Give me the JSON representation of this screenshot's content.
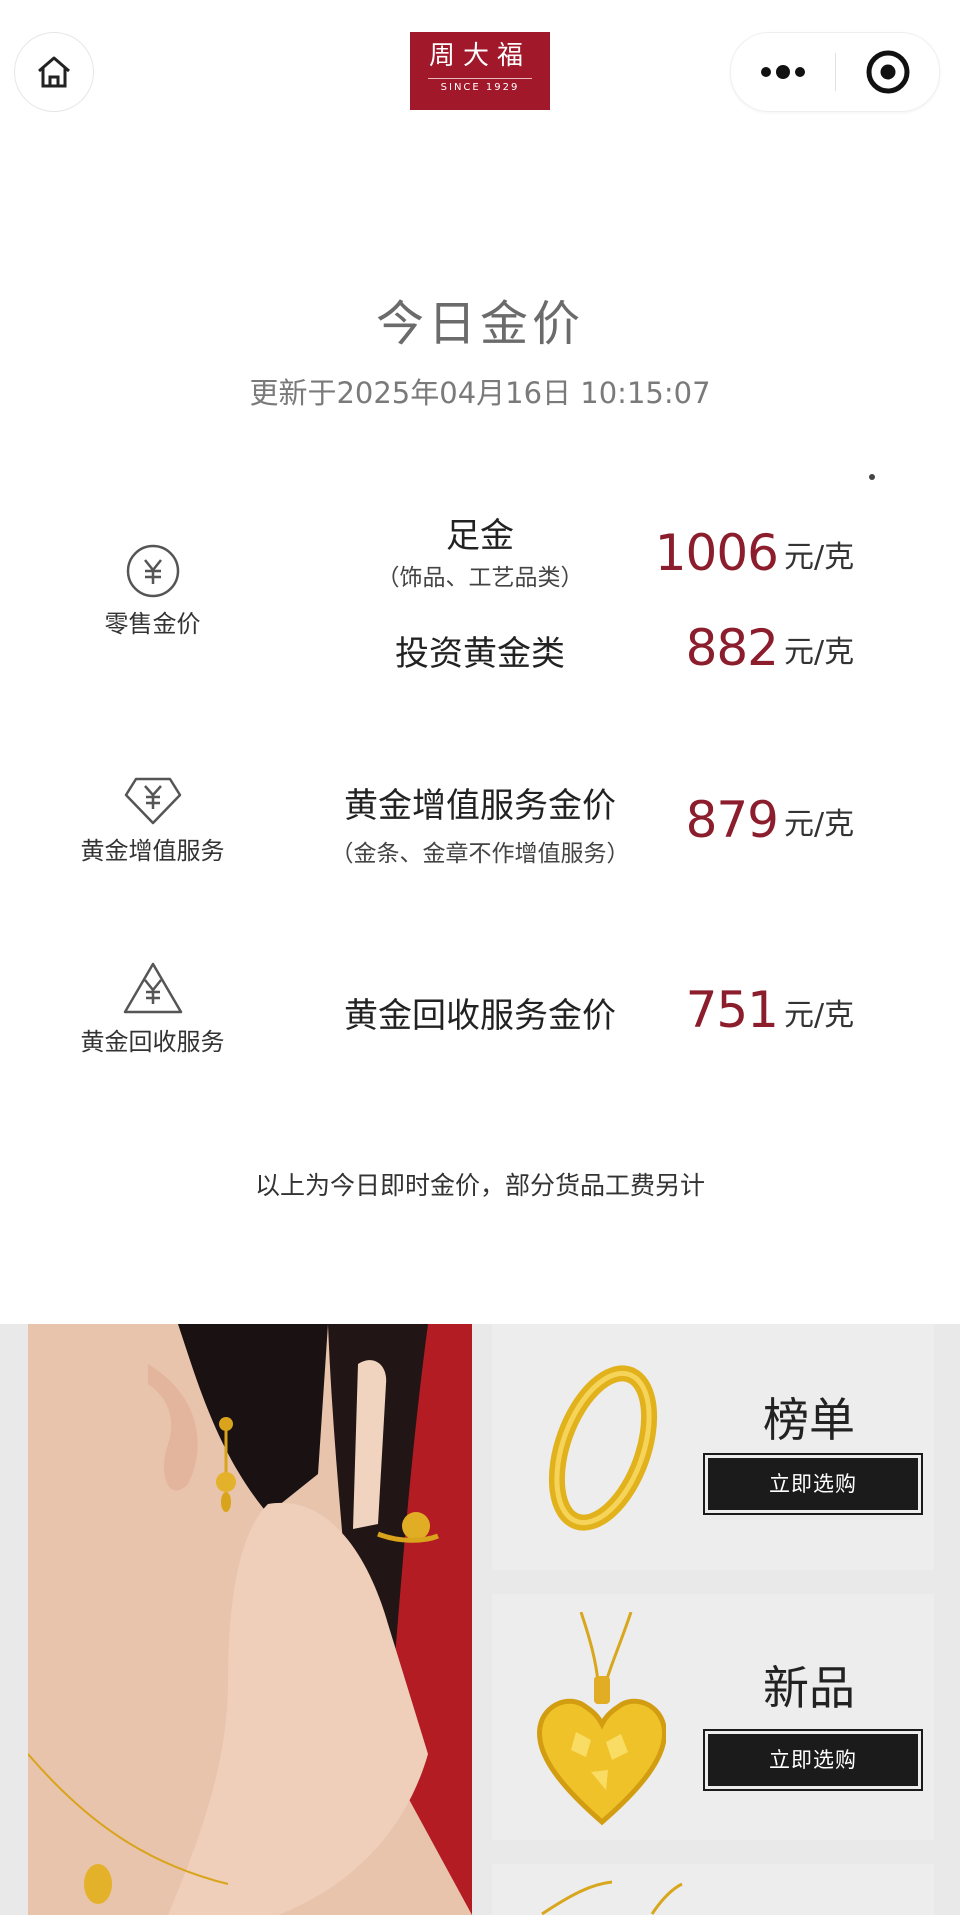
{
  "header": {
    "home_icon": "home-icon",
    "logo_cn": "周大福",
    "logo_en": "SINCE 1929",
    "more_icon": "more-dots-icon",
    "close_icon": "target-close-icon"
  },
  "main": {
    "title": "今日金价",
    "updated": "更新于2025年04月16日 10:15:07",
    "categories": [
      {
        "label": "零售金价",
        "icon": "yuan-circle-icon"
      },
      {
        "label": "黄金增值服务",
        "icon": "yuan-diamond-icon"
      },
      {
        "label": "黄金回收服务",
        "icon": "yuan-recycle-icon"
      }
    ],
    "prices": [
      {
        "name": "足金",
        "sub": "（饰品、工艺品类）",
        "value": "1006",
        "unit": "元/克"
      },
      {
        "name": "投资黄金类",
        "value": "882",
        "unit": "元/克"
      },
      {
        "name": "黄金增值服务金价",
        "sub": "（金条、金章不作增值服务）",
        "value": "879",
        "unit": "元/克"
      },
      {
        "name": "黄金回收服务金价",
        "value": "751",
        "unit": "元/克"
      }
    ],
    "note": "以上为今日即时金价，部分货品工费另计"
  },
  "banner": {
    "cards": [
      {
        "title": "榜单",
        "button": "立即选购"
      },
      {
        "title": "新品",
        "button": "立即选购"
      }
    ]
  },
  "colors": {
    "brand_red": "#a0182a",
    "price_red": "#8b1d2c"
  }
}
